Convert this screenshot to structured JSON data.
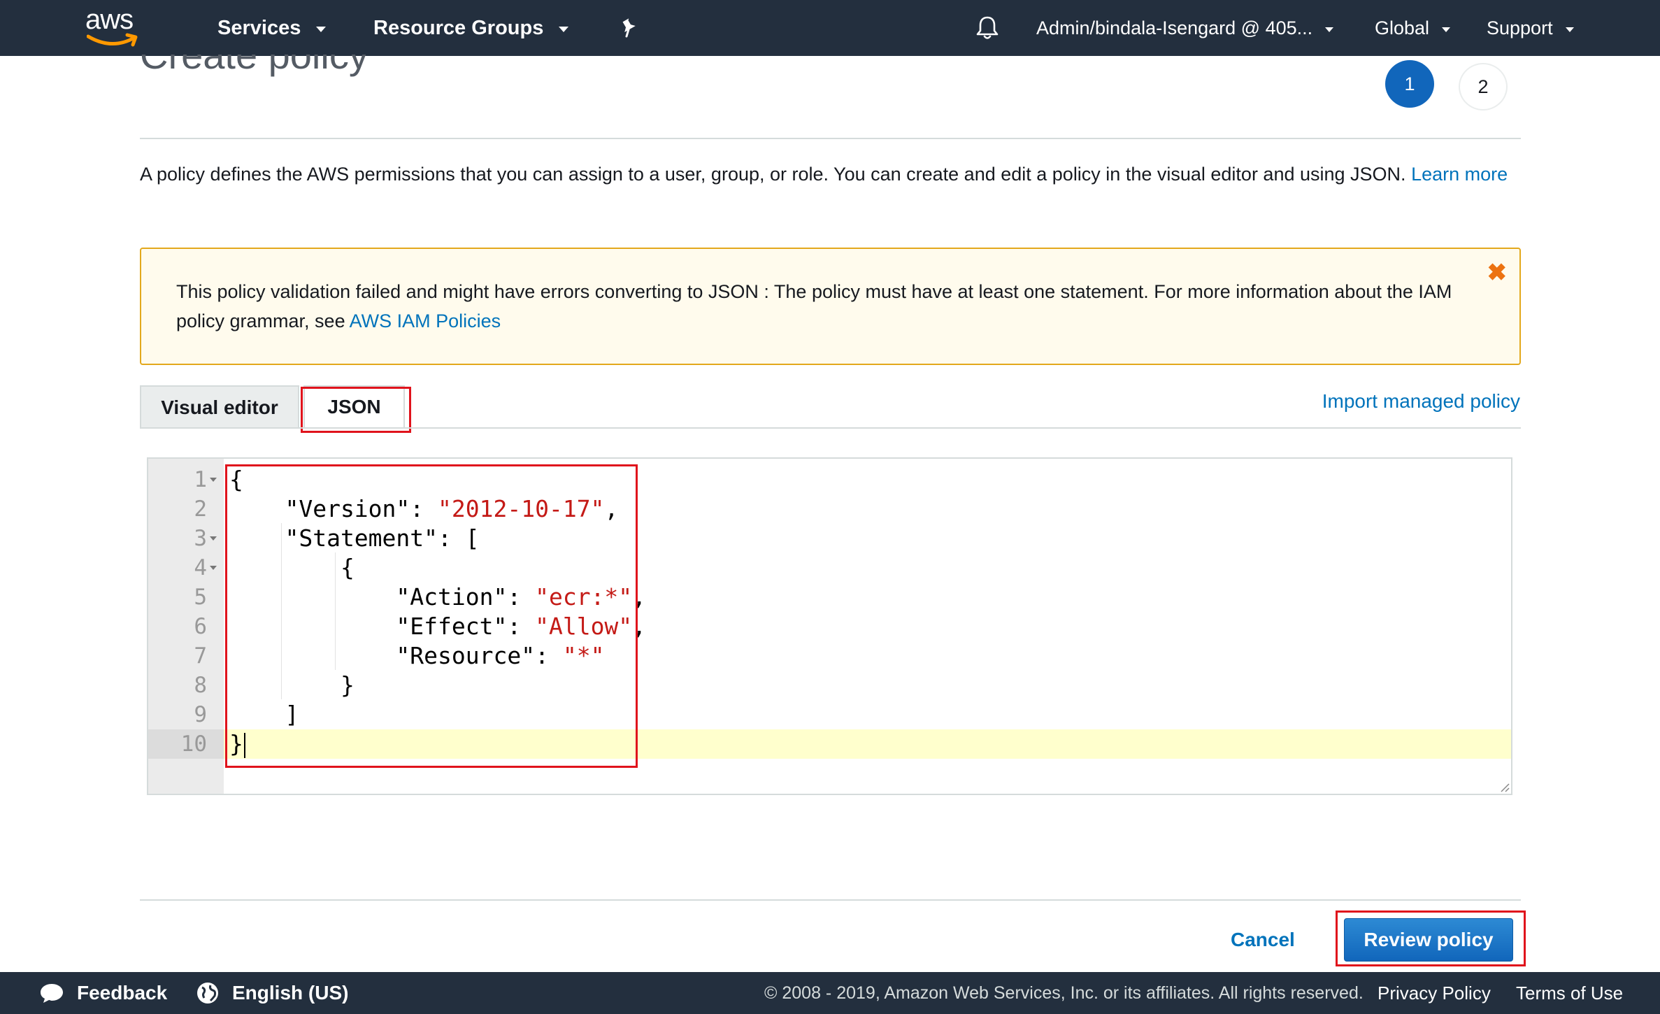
{
  "topnav": {
    "logo_text": "aws",
    "services": "Services",
    "resource_groups": "Resource Groups",
    "account": "Admin/bindala-Isengard @ 405...",
    "region": "Global",
    "support": "Support"
  },
  "page": {
    "title": "Create policy",
    "steps": [
      "1",
      "2"
    ]
  },
  "intro": {
    "text": "A policy defines the AWS permissions that you can assign to a user, group, or role. You can create and edit a policy in the visual editor and using JSON.",
    "link": "Learn more"
  },
  "alert": {
    "text": "This policy validation failed and might have errors converting to JSON : The policy must have at least one statement. For more information about the IAM policy grammar, see",
    "link": "AWS IAM Policies",
    "close_glyph": "✖"
  },
  "tabs": {
    "visual_editor": "Visual editor",
    "json": "JSON"
  },
  "import_link": "Import managed policy",
  "editor": {
    "line_numbers": [
      "1",
      "2",
      "3",
      "4",
      "5",
      "6",
      "7",
      "8",
      "9",
      "10"
    ],
    "lines": [
      {
        "pre": "{",
        "str": "",
        "post": ""
      },
      {
        "pre": "    \"Version\": ",
        "str": "\"2012-10-17\"",
        "post": ","
      },
      {
        "pre": "    \"Statement\": [",
        "str": "",
        "post": ""
      },
      {
        "pre": "        {",
        "str": "",
        "post": ""
      },
      {
        "pre": "            \"Action\": ",
        "str": "\"ecr:*\"",
        "post": ","
      },
      {
        "pre": "            \"Effect\": ",
        "str": "\"Allow\"",
        "post": ","
      },
      {
        "pre": "            \"Resource\": ",
        "str": "\"*\"",
        "post": ""
      },
      {
        "pre": "        }",
        "str": "",
        "post": ""
      },
      {
        "pre": "    ]",
        "str": "",
        "post": ""
      },
      {
        "pre": "}",
        "str": "",
        "post": ""
      }
    ],
    "active_line": 10
  },
  "actions": {
    "cancel": "Cancel",
    "review": "Review policy"
  },
  "footer": {
    "feedback": "Feedback",
    "language": "English (US)",
    "copyright": "© 2008 - 2019, Amazon Web Services, Inc. or its affiliates. All rights reserved.",
    "privacy": "Privacy Policy",
    "terms": "Terms of Use"
  },
  "colors": {
    "nav_bg": "#232f3e",
    "link": "#0073bb",
    "primary_button": "#1166bb",
    "alert_border": "#e3a81c",
    "alert_bg": "#fffbed",
    "highlight_box": "#e0131c",
    "json_string": "#c41a16"
  },
  "icons": [
    "bell-icon",
    "pin-icon",
    "close-icon",
    "feedback-bubble-icon",
    "globe-icon"
  ]
}
